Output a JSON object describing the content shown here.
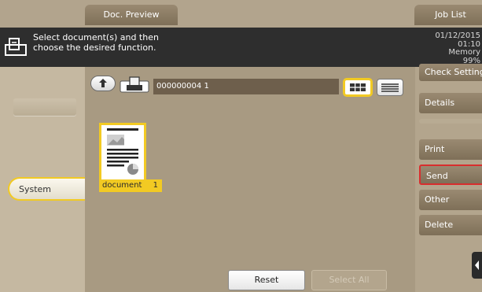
{
  "tabs": {
    "doc_preview": "Doc. Preview",
    "job_list": "Job List"
  },
  "message": {
    "line1": "Select document(s) and then",
    "line2": "choose the desired function."
  },
  "status": {
    "date": "01/12/2015",
    "time": "01:10",
    "memory_label": "Memory",
    "memory_value": "99%"
  },
  "left": {
    "system_label": "System"
  },
  "folder": {
    "path": "000000004 1"
  },
  "document": {
    "name": "document",
    "number": "1"
  },
  "right_menu": {
    "check_setting": "Check Setting",
    "details": "Details",
    "print": "Print",
    "send": "Send",
    "other": "Other",
    "delete": "Delete"
  },
  "buttons": {
    "reset": "Reset",
    "select_all": "Select All"
  },
  "colors": {
    "accent_yellow": "#f2ca23",
    "selected_red": "#d82e2e",
    "bar_dark": "#2e2e2e"
  },
  "icons": [
    "box-doc-icon",
    "folder-up-icon",
    "grid-view-icon",
    "list-view-icon",
    "document-thumbnail",
    "chevron-left-icon"
  ]
}
